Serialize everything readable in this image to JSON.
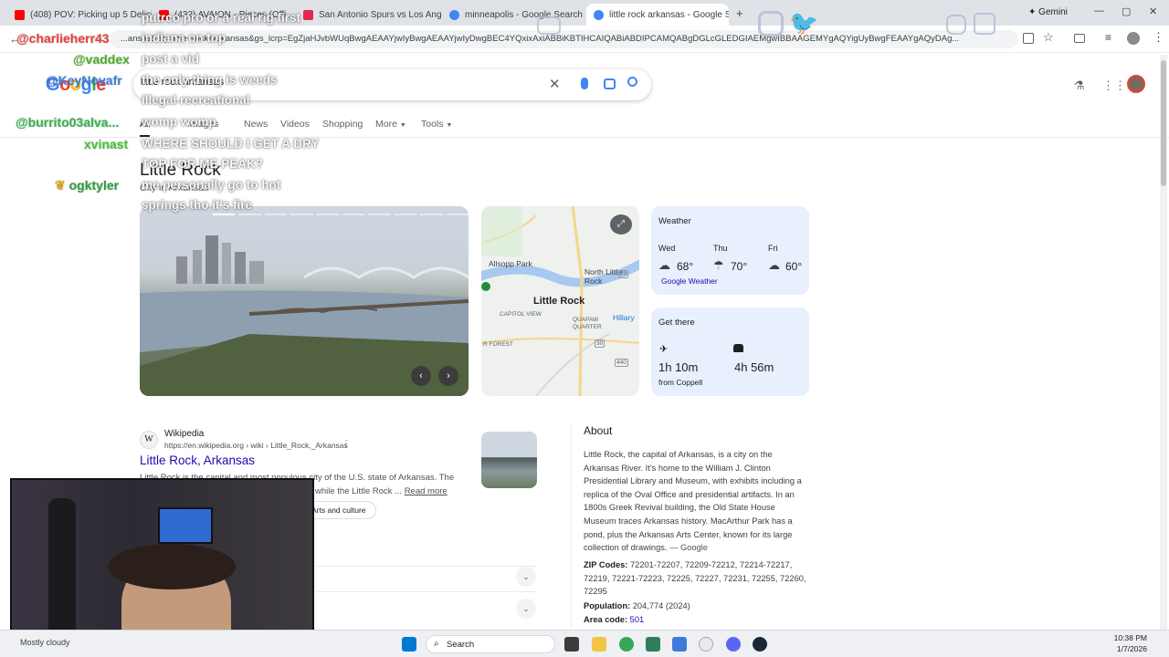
{
  "browser": {
    "tabs": [
      {
        "label": "(408) POV: Picking up 5 Delicio...",
        "fav_color": "#ff0000"
      },
      {
        "label": "(432) AVAION - Pieces (Offi...",
        "fav_color": "#ff0000"
      },
      {
        "label": "San Antonio Spurs vs Los Ange...",
        "fav_color": "#e22850"
      },
      {
        "label": "minneapolis - Google Search",
        "fav_color": "#4285f4"
      },
      {
        "label": "little rock arkansas - Google Se...",
        "fav_color": "#4285f4"
      }
    ],
    "gemini_label": "Gemini",
    "url": "...ansas&oq=little+rock+arkansas&gs_lcrp=EgZjaHJvbWUqBwgAEAAYjwIyBwgAEAAYjwIyDwgBEC4YQxixAxiABBiKBTIHCAIQABiABDIPCAMQABgDGLcGLEDGIAEMgwIBBAAGEMYgAQYigUyBwgFEAAYgAQyDAg..."
  },
  "google": {
    "search_value": "little rock arkansas",
    "tabs": [
      "All",
      "Images",
      "News",
      "Videos",
      "Shopping",
      "More",
      "Tools"
    ]
  },
  "chat": [
    {
      "name": "@charlieherr43",
      "color": "#e83d3d",
      "msg": "putrco pro or a real rig first"
    },
    {
      "name": "@vaddex",
      "color": "#4caf2a",
      "msg": "indiana on top"
    },
    {
      "name": "@KeyNovafr",
      "color": "#3b7ddd",
      "msg": "post a vid"
    },
    {
      "name": "",
      "color": "",
      "msg": "the only thing is weeds"
    },
    {
      "name": "",
      "color": "",
      "msg": "illegal recreational"
    },
    {
      "name": "@burrito03alva...",
      "color": "#35b24a",
      "msg": "womp womp"
    },
    {
      "name": "xvinast",
      "color": "#43c234",
      "msg": "WHERE SHOULD I GET A DRY"
    },
    {
      "name": "",
      "color": "",
      "msg": "TOP FOR ME PEAK?"
    },
    {
      "name": "ogktyler",
      "color": "#2e9a3a",
      "msg": "me personally go to hot"
    },
    {
      "name": "",
      "color": "",
      "msg": "springs tho it's fire"
    }
  ],
  "knowledge": {
    "title": "Little Rock",
    "subtitle": "City in Arkansas",
    "map_labels": {
      "north": "North Little Rock",
      "city": "Little Rock",
      "park": "Allsopp Park",
      "capitol": "CAPITOL VIEW",
      "quapaw": "QUAPAW QUARTER",
      "hillary": "Hillary",
      "forest": "R FOREST",
      "r70": "70",
      "r30": "30",
      "r440": "440"
    },
    "weather": {
      "title": "Weather",
      "days": [
        {
          "day": "Wed",
          "temp": "68°"
        },
        {
          "day": "Thu",
          "temp": "70°"
        },
        {
          "day": "Fri",
          "temp": "60°"
        }
      ],
      "source": "Google Weather"
    },
    "get_there": {
      "title": "Get there",
      "flight": "1h 10m",
      "from": "from Coppell",
      "drive": "4h 56m"
    }
  },
  "result": {
    "site": "Wikipedia",
    "url": "https://en.wikipedia.org › wiki › Little_Rock,_Arkansas",
    "title": "Little Rock, Arkansas",
    "snippet": "Little Rock is the capital and most populous city of the U.S. state of Arkansas. The",
    "snippet2": "while the Little Rock ...",
    "read_more": "Read more",
    "chip": "Arts and culture"
  },
  "about": {
    "heading": "About",
    "text": "Little Rock, the capital of Arkansas, is a city on the Arkansas River. It's home to the William J. Clinton Presidential Library and Museum, with exhibits including a replica of the Oval Office and presidential artifacts. In an 1800s Greek Revival building, the Old State House Museum traces Arkansas history. MacArthur Park has a pond, plus the Arkansas Arts Center, known for its large collection of drawings.",
    "source": "— Google",
    "zip_label": "ZIP Codes:",
    "zip_value": "72201-72207, 72209-72212, 72214-72217, 72219, 72221-72223, 72225, 72227, 72231, 72255, 72260, 72295",
    "pop_label": "Population:",
    "pop_value": "204,774 (2024)",
    "area_label": "Area code:",
    "area_value": "501"
  },
  "taskbar": {
    "search": "Search",
    "time": "10:38 PM",
    "date": "1/7/2026",
    "weather": "Mostly cloudy"
  }
}
